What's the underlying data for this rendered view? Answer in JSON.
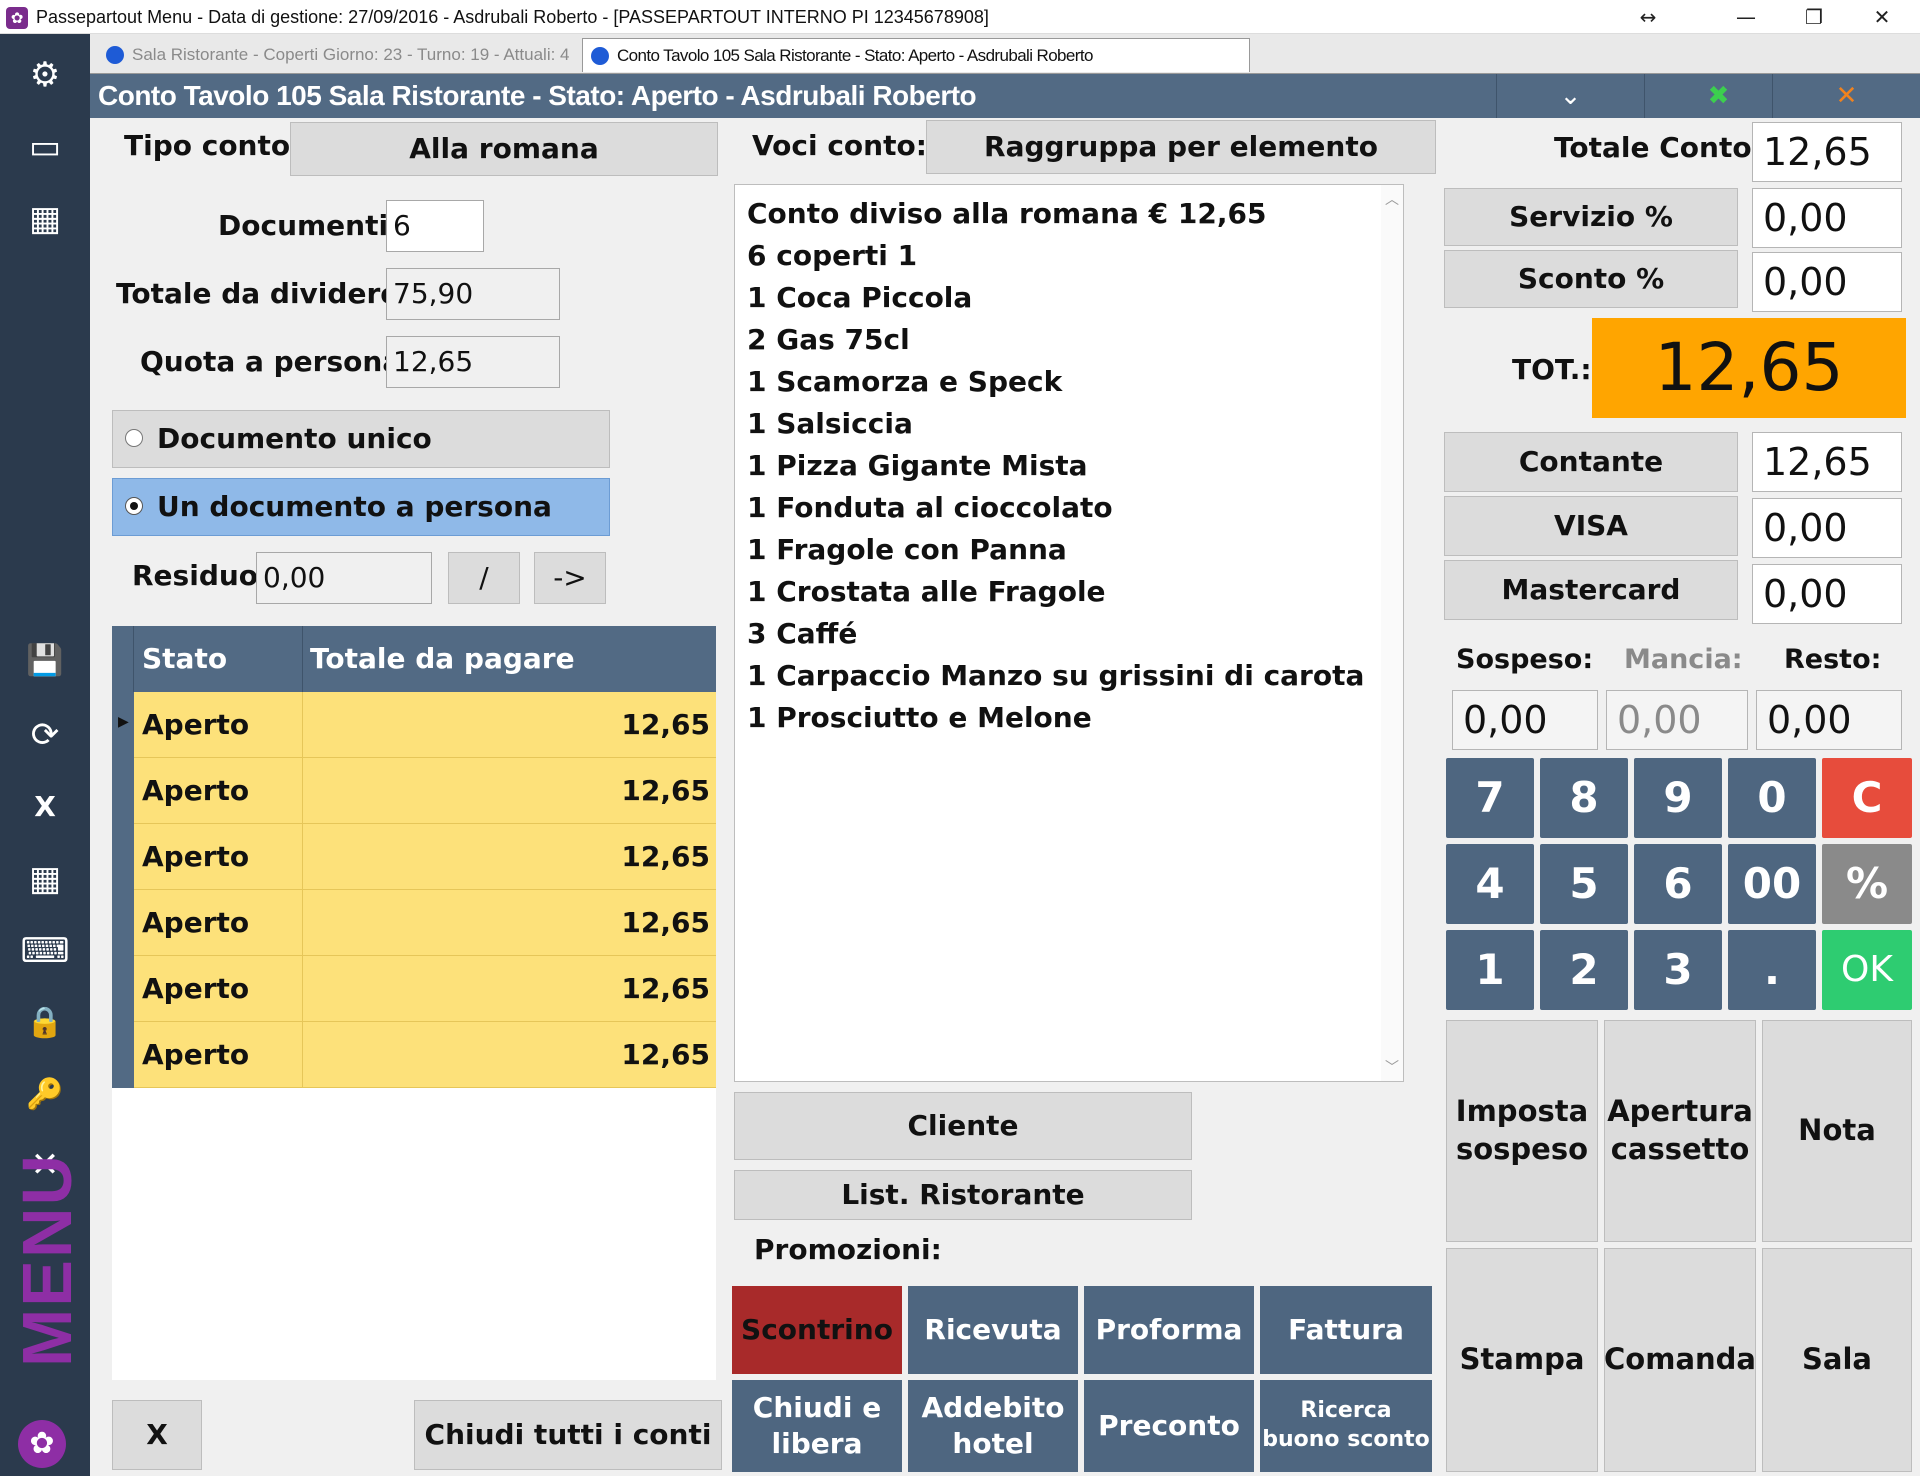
{
  "window": {
    "title": "Passepartout Menu - Data di gestione: 27/09/2016 - Asdrubali Roberto - [PASSEPARTOUT INTERNO PI 12345678908]",
    "resize_glyph": "↔",
    "minimize_glyph": "—",
    "restore_glyph": "❐",
    "close_glyph": "✕"
  },
  "sidebar": {
    "icons": [
      "gear-icon",
      "monitor-icon",
      "grid-icon",
      "save-icon",
      "refresh-icon",
      "excel-icon",
      "calculator-icon",
      "keyboard-icon",
      "lock-icon",
      "key-icon",
      "close-icon"
    ],
    "glyphs": [
      "⚙",
      "▭",
      "▦",
      "💾",
      "⟳",
      "X",
      "▦",
      "⌨",
      "🔒",
      "🔑",
      "✕"
    ],
    "menu_label": "MENU",
    "brand_color": "#8e2ea5"
  },
  "tabs": [
    {
      "label": "Sala Ristorante - Coperti Giorno: 23 - Turno: 19 - Attuali: 4",
      "active": false
    },
    {
      "label": "Conto Tavolo 105 Sala Ristorante - Stato: Aperto - Asdrubali Roberto",
      "active": true
    }
  ],
  "header": {
    "title": "Conto Tavolo 105 Sala Ristorante - Stato: Aperto - Asdrubali Roberto",
    "collapse_glyph": "⌄",
    "excel_glyph": "✖",
    "close_glyph": "✕"
  },
  "left": {
    "tipo_conto_label": "Tipo conto:",
    "tipo_conto_value": "Alla romana",
    "documenti_label": "Documenti:",
    "documenti_value": "6",
    "totale_dividere_label": "Totale da dividere:",
    "totale_dividere_value": "75,90",
    "quota_label": "Quota a persona:",
    "quota_value": "12,65",
    "radio_unico": "Documento unico",
    "radio_persona": "Un documento a persona",
    "residuo_label": "Residuo:",
    "residuo_value": "0,00",
    "slash_button": "/",
    "arrow_button": "->",
    "grid_headers": [
      "Stato",
      "Totale da pagare"
    ],
    "grid_rows": [
      {
        "stato": "Aperto",
        "totale": "12,65"
      },
      {
        "stato": "Aperto",
        "totale": "12,65"
      },
      {
        "stato": "Aperto",
        "totale": "12,65"
      },
      {
        "stato": "Aperto",
        "totale": "12,65"
      },
      {
        "stato": "Aperto",
        "totale": "12,65"
      },
      {
        "stato": "Aperto",
        "totale": "12,65"
      }
    ],
    "x_button": "X",
    "chiudi_tutti": "Chiudi tutti i conti"
  },
  "middle": {
    "voci_label": "Voci conto:",
    "raggruppa_button": "Raggruppa per elemento",
    "items": [
      "Conto diviso alla romana € 12,65",
      "6 coperti 1",
      "1 Coca Piccola",
      "2 Gas 75cl",
      "1 Scamorza e Speck",
      "1 Salsiccia",
      "1 Pizza Gigante Mista",
      "1 Fonduta al cioccolato",
      "1 Fragole con Panna",
      "1 Crostata alle Fragole",
      "3 Caffé",
      "1 Carpaccio Manzo su grissini di carota",
      "1 Prosciutto e Melone"
    ],
    "cliente_button": "Cliente",
    "listino_button": "List. Ristorante",
    "promozioni_label": "Promozioni:",
    "doc_buttons": [
      {
        "label": "Scontrino",
        "selected": true
      },
      {
        "label": "Ricevuta",
        "selected": false
      },
      {
        "label": "Proforma",
        "selected": false
      },
      {
        "label": "Fattura",
        "selected": false
      }
    ],
    "action_buttons": [
      "Chiudi e libera",
      "Addebito hotel",
      "Preconto",
      "Ricerca buono sconto"
    ],
    "selected_color": "#a82a2a"
  },
  "right": {
    "totale_conto_label": "Totale Conto:",
    "totale_conto_value": "12,65",
    "servizio_label": "Servizio %",
    "servizio_value": "0,00",
    "sconto_label": "Sconto %",
    "sconto_value": "0,00",
    "tot_label": "TOT.:",
    "tot_value": "12,65",
    "tot_color": "#ffa500",
    "payments": [
      {
        "label": "Contante",
        "value": "12,65"
      },
      {
        "label": "VISA",
        "value": "0,00"
      },
      {
        "label": "Mastercard",
        "value": "0,00"
      }
    ],
    "sospeso_label": "Sospeso:",
    "sospeso_value": "0,00",
    "mancia_label": "Mancia:",
    "mancia_value": "0,00",
    "resto_label": "Resto:",
    "resto_value": "0,00",
    "keypad": [
      [
        "7",
        "8",
        "9",
        "0",
        "C"
      ],
      [
        "4",
        "5",
        "6",
        "00",
        "%"
      ],
      [
        "1",
        "2",
        "3",
        ".",
        "OK"
      ]
    ],
    "key_colors": {
      "normal": "#4e6680",
      "clear": "#e74c3c",
      "percent": "#8a8a8a",
      "ok": "#2ecc71"
    },
    "big_buttons": [
      "Imposta sospeso",
      "Apertura cassetto",
      "Nota",
      "Stampa",
      "Comanda",
      "Sala"
    ]
  }
}
